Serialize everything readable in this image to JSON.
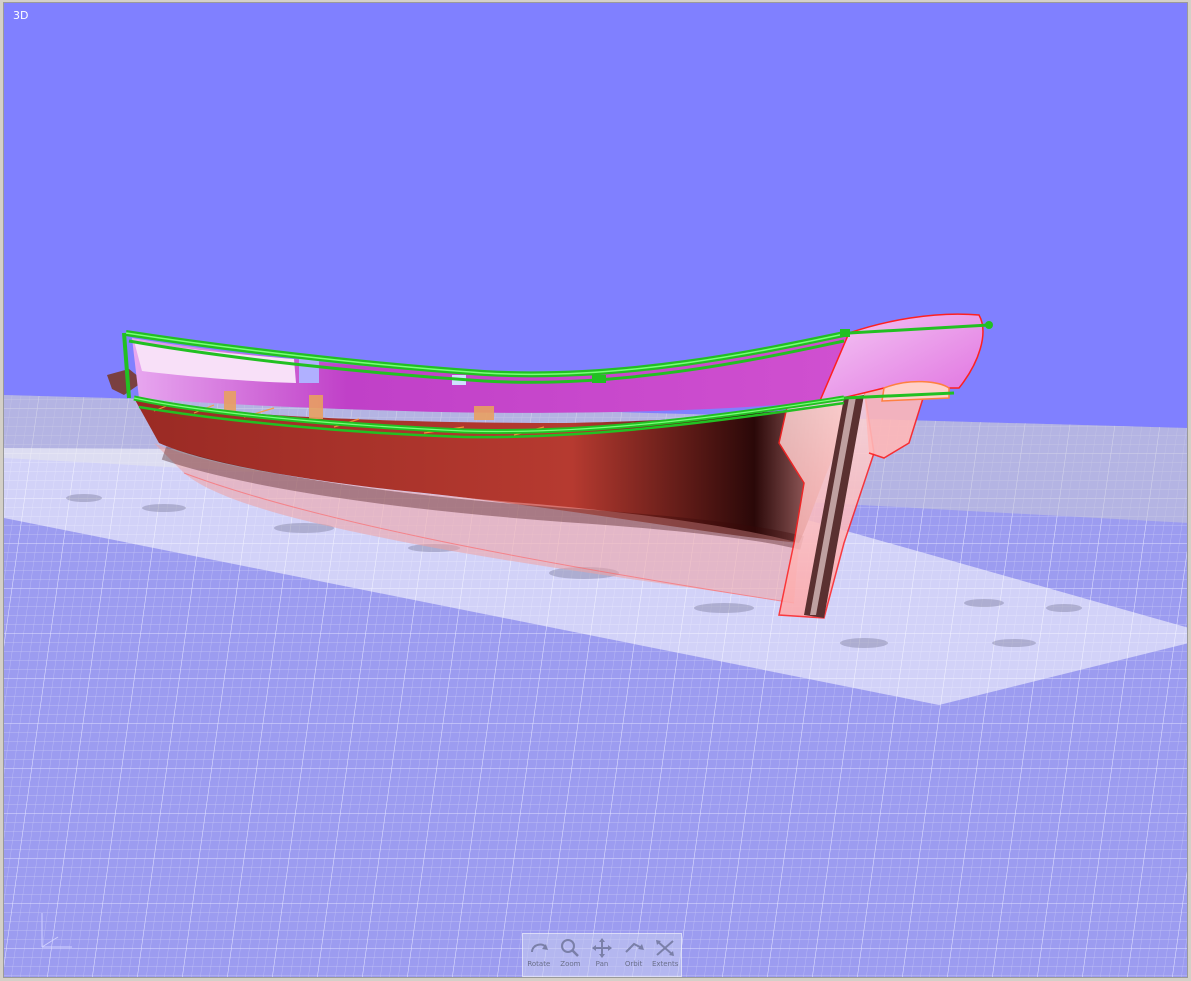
{
  "viewport": {
    "label": "3D"
  },
  "colors": {
    "background": "#8080ff",
    "grid_plane": "#a8a8ee",
    "hull_red": "#b8302a",
    "rail_green": "#22c022",
    "bulwark_magenta": "#d040d0"
  },
  "nav_toolbar": {
    "buttons": [
      {
        "label": "Rotate",
        "icon": "rotate-icon"
      },
      {
        "label": "Zoom",
        "icon": "zoom-icon"
      },
      {
        "label": "Pan",
        "icon": "pan-icon"
      },
      {
        "label": "Orbit",
        "icon": "orbit-icon"
      },
      {
        "label": "Extents",
        "icon": "extents-icon"
      }
    ]
  }
}
